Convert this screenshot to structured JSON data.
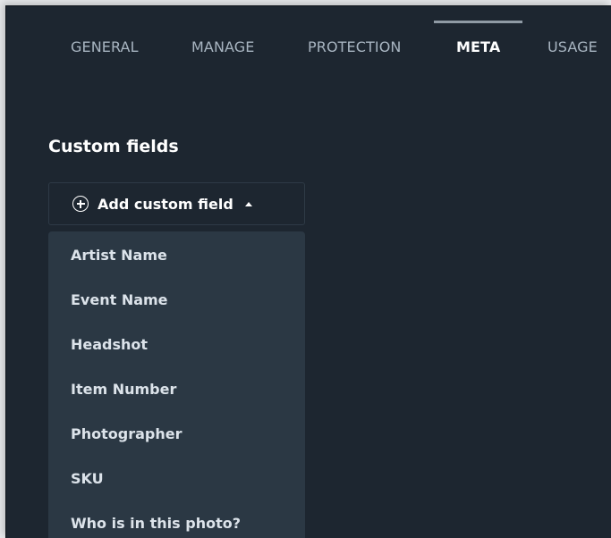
{
  "tabs": [
    {
      "label": "GENERAL"
    },
    {
      "label": "MANAGE"
    },
    {
      "label": "PROTECTION"
    },
    {
      "label": "META"
    },
    {
      "label": "USAGE"
    }
  ],
  "active_tab": "META",
  "custom_fields": {
    "title": "Custom fields",
    "add_button_label": "Add custom field",
    "add_icon": "plus-circle-icon",
    "caret_icon": "caret-up-icon"
  },
  "dropdown": {
    "items": [
      {
        "label": "Artist Name"
      },
      {
        "label": "Event Name"
      },
      {
        "label": "Headshot"
      },
      {
        "label": "Item Number"
      },
      {
        "label": "Photographer"
      },
      {
        "label": "SKU"
      },
      {
        "label": "Who is in this photo?"
      }
    ]
  },
  "colors": {
    "background": "#1d2630",
    "dropdown_bg": "#2b3844",
    "tab_text": "#a8b5c1",
    "active_text": "#ffffff"
  }
}
